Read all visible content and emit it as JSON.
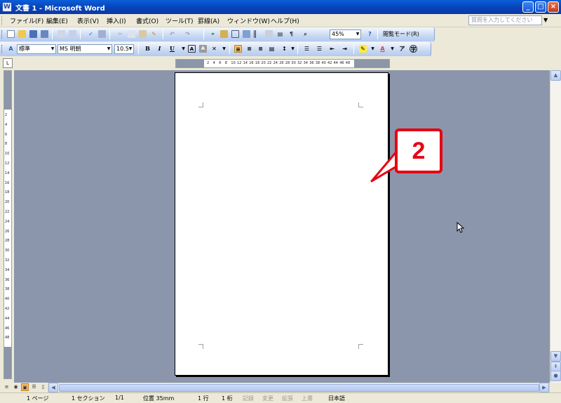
{
  "window": {
    "title": "文書 1 - Microsoft Word",
    "app_icon_glyph": "W",
    "minimize_label": "_",
    "maximize_label": "□",
    "close_label": "×"
  },
  "menu": {
    "items": [
      "ファイル(F)",
      "編集(E)",
      "表示(V)",
      "挿入(I)",
      "書式(O)",
      "ツール(T)",
      "罫線(A)",
      "ウィンドウ(W)",
      "ヘルプ(H)"
    ],
    "help_placeholder": "質問を入力してください"
  },
  "standard_toolbar": {
    "zoom_value": "45%",
    "read_mode_label": "閲覧モード(R)"
  },
  "formatting_toolbar": {
    "style_value": "標準",
    "font_value": "MS 明朝",
    "size_value": "10.5",
    "bold_label": "B",
    "italic_label": "I",
    "underline_label": "U"
  },
  "ruler": {
    "ticks": [
      "2",
      "4",
      "6",
      "8",
      "10",
      "12",
      "14",
      "16",
      "18",
      "20",
      "22",
      "24",
      "26",
      "28",
      "30",
      "32",
      "34",
      "36",
      "38",
      "40",
      "42",
      "44",
      "46",
      "48"
    ],
    "vertical_ticks": [
      "2",
      "4",
      "6",
      "8",
      "10",
      "12",
      "14",
      "16",
      "18",
      "20",
      "22",
      "24",
      "26",
      "28",
      "30",
      "32",
      "34",
      "36",
      "38",
      "40",
      "42",
      "44",
      "46",
      "48"
    ]
  },
  "callout": {
    "number": "2",
    "color": "#e60012"
  },
  "statusbar": {
    "page": "1 ページ",
    "section": "1 セクション",
    "page_of": "1/1",
    "position": "位置 35mm",
    "line": "1 行",
    "column": "1 桁",
    "rec": "記録",
    "trk": "変更",
    "ext": "拡張",
    "ovr": "上書",
    "language": "日本語"
  }
}
